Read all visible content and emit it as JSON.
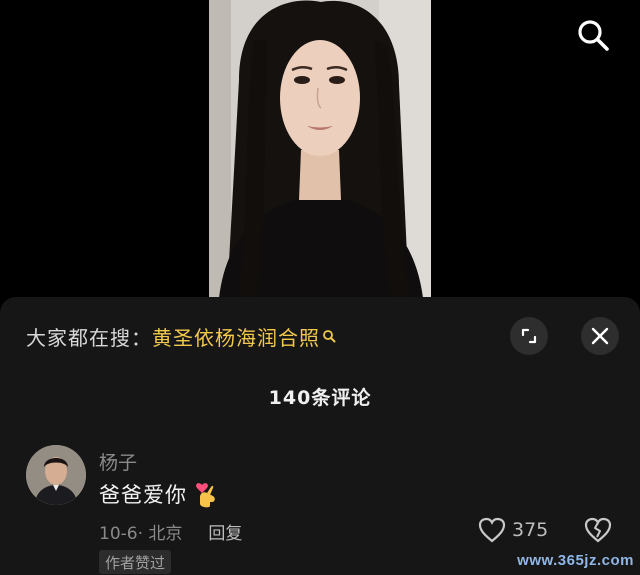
{
  "video": {
    "description_icon": "portrait-video-frame"
  },
  "top_bar": {
    "search_icon": "search-icon"
  },
  "trending": {
    "prefix": "大家都在搜：",
    "query": "黄圣依杨海润合照",
    "query_color": "#f2c94c"
  },
  "sheet": {
    "expand_icon": "expand-icon",
    "close_icon": "close-icon",
    "count_title": "140条评论"
  },
  "comment": {
    "username": "杨子",
    "text": "爸爸爱你",
    "emoji_icon": "finger-heart-icon",
    "date_location": "10-6· 北京",
    "reply_label": "回复",
    "like_count": "375",
    "author_badge": "作者赞过"
  },
  "watermark": "www.365jz.com"
}
